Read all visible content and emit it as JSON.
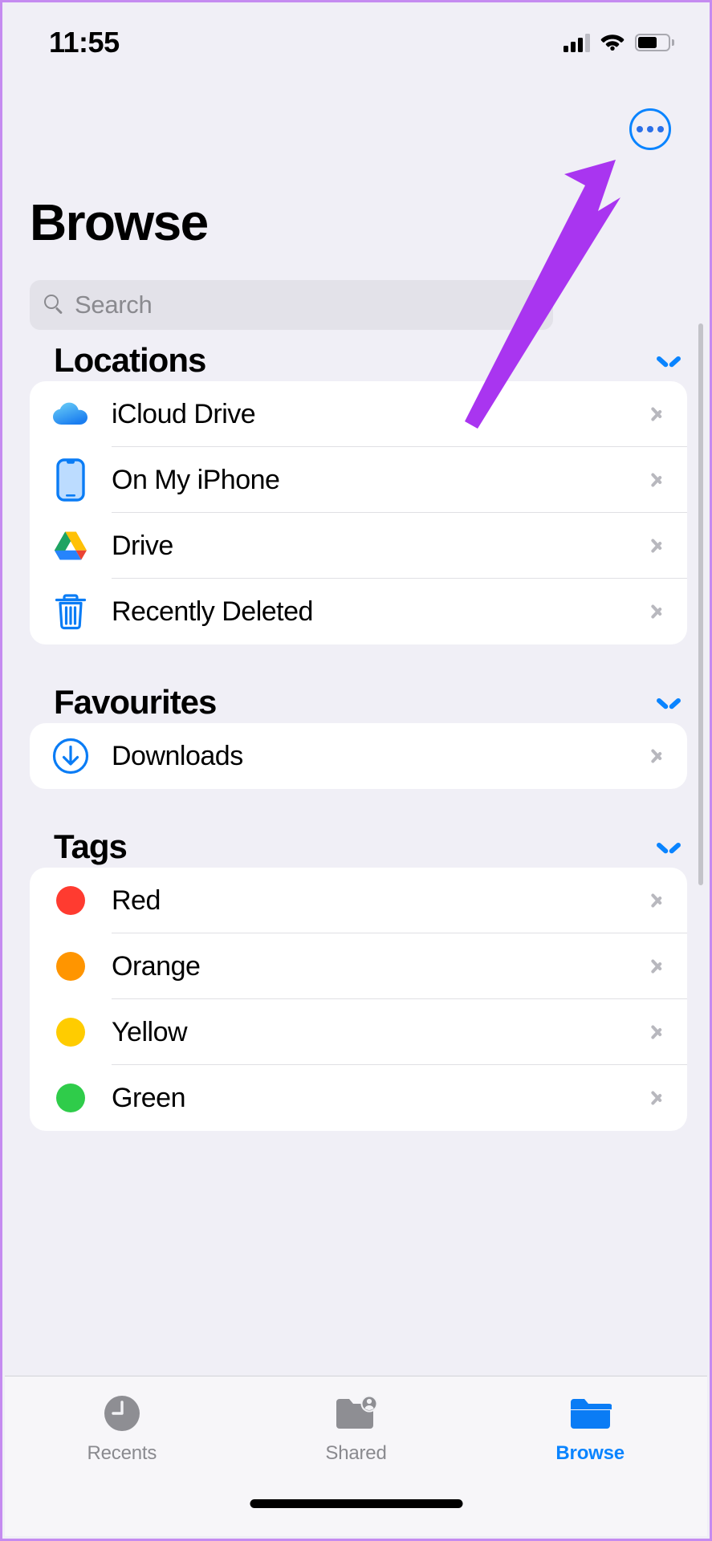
{
  "status_bar": {
    "time": "11:55",
    "signal_icon": "cellular-signal-icon",
    "signal_bars_filled": 3,
    "signal_bars_total": 4,
    "wifi_icon": "wifi-icon",
    "battery_icon": "battery-icon",
    "battery_percent": 65
  },
  "nav": {
    "more_button_label": "more-options",
    "more_icon": "ellipsis-circle-icon",
    "accent_color": "#0a84ff"
  },
  "header": {
    "title": "Browse"
  },
  "search": {
    "placeholder": "Search",
    "value": "",
    "icon": "search-icon"
  },
  "sections": [
    {
      "id": "locations",
      "title": "Locations",
      "collapse_icon": "chevron-down-icon",
      "items": [
        {
          "label": "iCloud Drive",
          "icon": "icloud-drive-icon",
          "disclosure": "chevron-right-icon"
        },
        {
          "label": "On My iPhone",
          "icon": "iphone-icon",
          "disclosure": "chevron-right-icon"
        },
        {
          "label": "Drive",
          "icon": "google-drive-icon",
          "disclosure": "chevron-right-icon"
        },
        {
          "label": "Recently Deleted",
          "icon": "trash-icon",
          "disclosure": "chevron-right-icon"
        }
      ]
    },
    {
      "id": "favourites",
      "title": "Favourites",
      "collapse_icon": "chevron-down-icon",
      "items": [
        {
          "label": "Downloads",
          "icon": "download-circle-icon",
          "disclosure": "chevron-right-icon"
        }
      ]
    },
    {
      "id": "tags",
      "title": "Tags",
      "collapse_icon": "chevron-down-icon",
      "items": [
        {
          "label": "Red",
          "icon": "tag-dot-icon",
          "color": "#ff3b30",
          "disclosure": "chevron-right-icon"
        },
        {
          "label": "Orange",
          "icon": "tag-dot-icon",
          "color": "#ff9500",
          "disclosure": "chevron-right-icon"
        },
        {
          "label": "Yellow",
          "icon": "tag-dot-icon",
          "color": "#ffcc00",
          "disclosure": "chevron-right-icon"
        },
        {
          "label": "Green",
          "icon": "tag-dot-icon",
          "color": "#2fcc4a",
          "disclosure": "chevron-right-icon"
        }
      ]
    }
  ],
  "tab_bar": {
    "items": [
      {
        "label": "Recents",
        "icon": "clock-icon",
        "active": false
      },
      {
        "label": "Shared",
        "icon": "shared-folder-icon",
        "active": false
      },
      {
        "label": "Browse",
        "icon": "folder-icon",
        "active": true
      }
    ],
    "active_color": "#0a84ff",
    "inactive_color": "#8a8a8f"
  },
  "annotation": {
    "arrow_color": "#a935f0",
    "points_to": "more-options-button"
  }
}
